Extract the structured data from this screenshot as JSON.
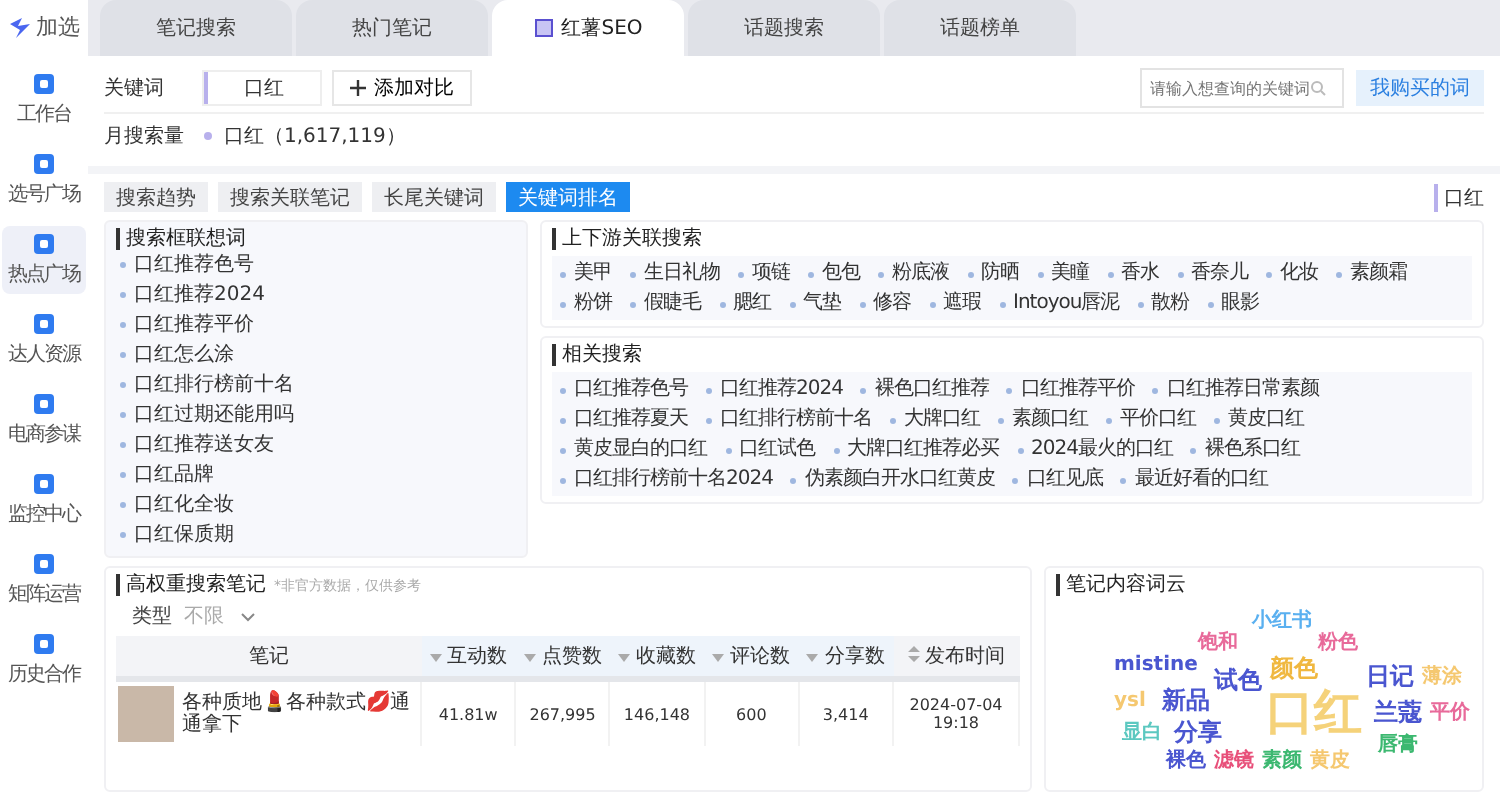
{
  "brand": "加选",
  "sidebar": {
    "items": [
      {
        "label": "工作台",
        "selected": false
      },
      {
        "label": "选号广场",
        "selected": false
      },
      {
        "label": "热点广场",
        "selected": true
      },
      {
        "label": "达人资源",
        "selected": false
      },
      {
        "label": "电商参谋",
        "selected": false
      },
      {
        "label": "监控中心",
        "selected": false
      },
      {
        "label": "矩阵运营",
        "selected": false
      },
      {
        "label": "历史合作",
        "selected": false
      }
    ]
  },
  "tabs": [
    {
      "label": "笔记搜索",
      "selected": false
    },
    {
      "label": "热门笔记",
      "selected": false
    },
    {
      "label": "红薯SEO",
      "selected": true
    },
    {
      "label": "话题搜索",
      "selected": false
    },
    {
      "label": "话题榜单",
      "selected": false
    }
  ],
  "keyword_panel": {
    "keyword_label": "关键词",
    "keyword": "口红",
    "add_button": "添加对比",
    "search": {
      "placeholder": "请输入想查询的关键词"
    },
    "bought_button": "我购买的词",
    "volume_label": "月搜索量",
    "volume": "口红（1,617,119）"
  },
  "sub_tabs": [
    {
      "label": "搜索趋势",
      "selected": false
    },
    {
      "label": "搜索关联笔记",
      "selected": false
    },
    {
      "label": "长尾关键词",
      "selected": false
    },
    {
      "label": "关键词排名",
      "selected": true
    }
  ],
  "legend": "口红",
  "suggestions": {
    "title": "搜索框联想词",
    "items": [
      "口红推荐色号",
      "口红推荐2024",
      "口红推荐平价",
      "口红怎么涂",
      "口红排行榜前十名",
      "口红过期还能用吗",
      "口红推荐送女友",
      "口红品牌",
      "口红化全妆",
      "口红保质期"
    ]
  },
  "upstream": {
    "title": "上下游关联搜索",
    "items": [
      "美甲",
      "生日礼物",
      "项链",
      "包包",
      "粉底液",
      "防晒",
      "美瞳",
      "香水",
      "香奈儿",
      "化妆",
      "素颜霜",
      "粉饼",
      "假睫毛",
      "腮红",
      "气垫",
      "修容",
      "遮瑕",
      "Intoyou唇泥",
      "散粉",
      "眼影"
    ]
  },
  "related": {
    "title": "相关搜索",
    "items": [
      "口红推荐色号",
      "口红推荐2024",
      "裸色口红推荐",
      "口红推荐平价",
      "口红推荐日常素颜",
      "口红推荐夏天",
      "口红排行榜前十名",
      "大牌口红",
      "素颜口红",
      "平价口红",
      "黄皮口红",
      "黄皮显白的口红",
      "口红试色",
      "大牌口红推荐必买",
      "2024最火的口红",
      "裸色系口红",
      "口红排行榜前十名2024",
      "伪素颜白开水口红黄皮",
      "口红见底",
      "最近好看的口红"
    ]
  },
  "notes": {
    "title": "高权重搜索笔记",
    "note": "*非官方数据，仅供参考",
    "filter_label": "类型",
    "filter_value": "不限",
    "columns": [
      {
        "label": "笔记",
        "kind": "plain"
      },
      {
        "label": "互动数",
        "kind": "sort"
      },
      {
        "label": "点赞数",
        "kind": "sort"
      },
      {
        "label": "收藏数",
        "kind": "sort"
      },
      {
        "label": "评论数",
        "kind": "sort"
      },
      {
        "label": "分享数",
        "kind": "sort"
      },
      {
        "label": "发布时间",
        "kind": "sort_both"
      }
    ],
    "rows": [
      {
        "cells": [
          "各种质地💄各种款式💋通通拿下",
          "41.81w",
          "267,995",
          "146,148",
          "600",
          "3,414",
          "2024-07-04 19:18"
        ]
      }
    ]
  },
  "word_cloud": {
    "title": "笔记内容词云",
    "words": [
      {
        "text": "小红书",
        "color": "#5ab0f0",
        "kind": "small"
      },
      {
        "text": "饱和",
        "color": "#e86a9a",
        "kind": "small"
      },
      {
        "text": "粉色",
        "color": "#e86a9a",
        "kind": "small"
      },
      {
        "text": "mistine",
        "color": "#4a56d0",
        "kind": "small"
      },
      {
        "text": "颜色",
        "color": "#f0b840",
        "kind": "medium"
      },
      {
        "text": "试色",
        "color": "#4a56d0",
        "kind": "medium"
      },
      {
        "text": "日记",
        "color": "#4a56d0",
        "kind": "medium"
      },
      {
        "text": "薄涂",
        "color": "#f5c870",
        "kind": "small"
      },
      {
        "text": "ysl",
        "color": "#f5c870",
        "kind": "small"
      },
      {
        "text": "新品",
        "color": "#4a56d0",
        "kind": "medium"
      },
      {
        "text": "口红",
        "color": "#f5d27a",
        "kind": "main"
      },
      {
        "text": "兰蔻",
        "color": "#4a56d0",
        "kind": "medium"
      },
      {
        "text": "平价",
        "color": "#e86a9a",
        "kind": "small"
      },
      {
        "text": "显白",
        "color": "#5cc8c0",
        "kind": "small"
      },
      {
        "text": "分享",
        "color": "#4a56d0",
        "kind": "medium"
      },
      {
        "text": "唇膏",
        "color": "#3cb870",
        "kind": "small"
      },
      {
        "text": "裸色",
        "color": "#4a56d0",
        "kind": "small"
      },
      {
        "text": "滤镜",
        "color": "#e8507a",
        "kind": "small"
      },
      {
        "text": "素颜",
        "color": "#3cb870",
        "kind": "small"
      },
      {
        "text": "黄皮",
        "color": "#f5c870",
        "kind": "small"
      }
    ]
  }
}
